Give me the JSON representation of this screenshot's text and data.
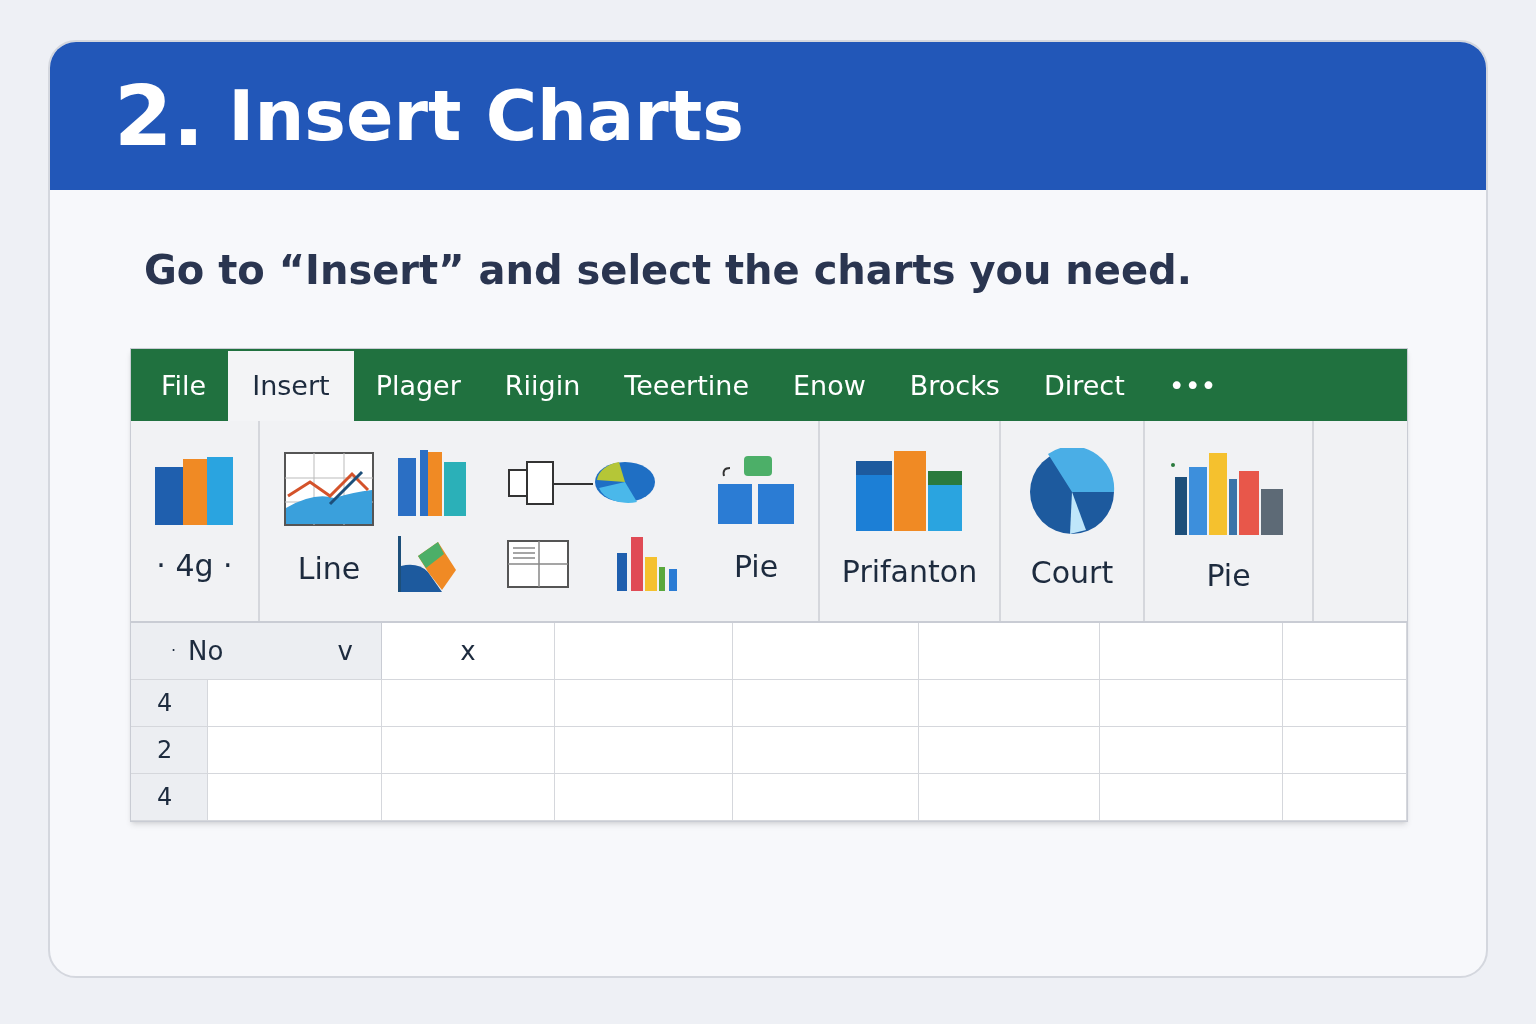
{
  "header": {
    "step": "2.",
    "title": "Insert Charts"
  },
  "instruction": "Go to “Insert” and select the charts you need.",
  "tabs": [
    {
      "label": "File",
      "selected": false
    },
    {
      "label": "Insert",
      "selected": true
    },
    {
      "label": "Plager",
      "selected": false
    },
    {
      "label": "Riigin",
      "selected": false
    },
    {
      "label": "Teeertine",
      "selected": false
    },
    {
      "label": "Enow",
      "selected": false
    },
    {
      "label": "Brocks",
      "selected": false
    },
    {
      "label": "Direct",
      "selected": false
    },
    {
      "label": "•••",
      "selected": false
    }
  ],
  "ribbon": [
    {
      "kind": "large",
      "label": "· 4g ·"
    },
    {
      "kind": "gallery",
      "line_label": "Line",
      "pie_label": "Pie"
    },
    {
      "kind": "large",
      "label": "Prifanton"
    },
    {
      "kind": "large",
      "label": "Court"
    },
    {
      "kind": "large",
      "label": "Pie"
    }
  ],
  "grid": {
    "name_box": {
      "dot": "·",
      "value": "No",
      "caret": "v"
    },
    "cancel": "x",
    "rows": [
      "4",
      "2",
      "4"
    ]
  }
}
